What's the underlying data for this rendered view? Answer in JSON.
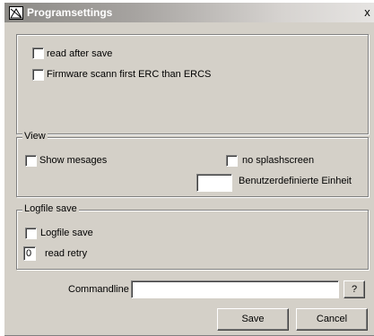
{
  "window": {
    "title": "Programsettings",
    "close_label": "x"
  },
  "general": {
    "read_after_save": "read after save",
    "firmware_scan": "Firmware scann first ERC than ERCS"
  },
  "view": {
    "legend": "View",
    "show_messages": "Show mesages",
    "no_splashscreen": "no splashscreen",
    "custom_unit_label": "Benutzerdefinierte Einheit",
    "custom_unit_value": ""
  },
  "logfile": {
    "legend": "Logfile save",
    "logfile_save": "Logfile save",
    "read_retry_value": "0",
    "read_retry_label": "read retry"
  },
  "commandline": {
    "label": "Commandline",
    "value": "",
    "help_button": "?"
  },
  "buttons": {
    "save": "Save",
    "cancel": "Cancel"
  }
}
